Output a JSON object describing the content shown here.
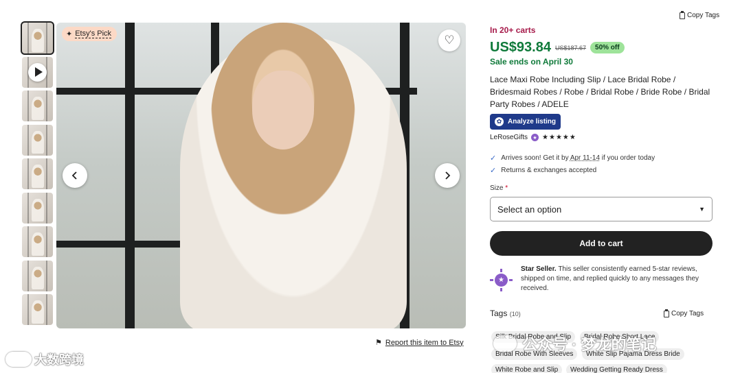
{
  "gallery": {
    "thumbnail_count": 9,
    "badge": "Etsy's Pick",
    "report_link": "Report this item to Etsy"
  },
  "listing": {
    "carts": "In 20+ carts",
    "price": "US$93.84",
    "original_price": "US$187.67",
    "discount": "50% off",
    "sale_ends": "Sale ends on April 30",
    "title": "Lace Maxi Robe Including Slip / Lace Bridal Robe / Bridesmaid Robes / Robe / Bridal Robe / Bride Robe / Bridal Party Robes / ADELE",
    "analyze_label": "Analyze listing",
    "shop_name": "LeRoseGifts",
    "rating_stars": "★★★★★",
    "arrival_pre": "Arrives soon! Get it by",
    "arrival_dates": "Apr 11-14",
    "arrival_post": "if you order today",
    "returns": "Returns & exchanges accepted",
    "size_label": "Size",
    "size_required": "*",
    "size_placeholder": "Select an option",
    "add_to_cart": "Add to cart",
    "star_seller_title": "Star Seller.",
    "star_seller_text": "This seller consistently earned 5-star reviews, shipped on time, and replied quickly to any messages they received."
  },
  "tags": {
    "heading": "Tags",
    "count": "(10)",
    "copy_label": "Copy Tags",
    "items": [
      "Silk Bridal Robe and Slip",
      "Bridal Robe Short Lace",
      "Bridal Robe With Sleeves",
      "White Slip Pajama Dress Bride",
      "White Robe and Slip",
      "Wedding Getting Ready Dress"
    ]
  },
  "top_copy_tags": "Copy Tags",
  "watermarks": {
    "left": "大数跨境",
    "right": "公众号 · 梦龙的笔记"
  },
  "colors": {
    "price_green": "#0f7a3a",
    "carts_red": "#a61a4a",
    "analyze_blue": "#1f3a8a",
    "star_seller_purple": "#8a5cc8",
    "cart_button": "#222222"
  }
}
